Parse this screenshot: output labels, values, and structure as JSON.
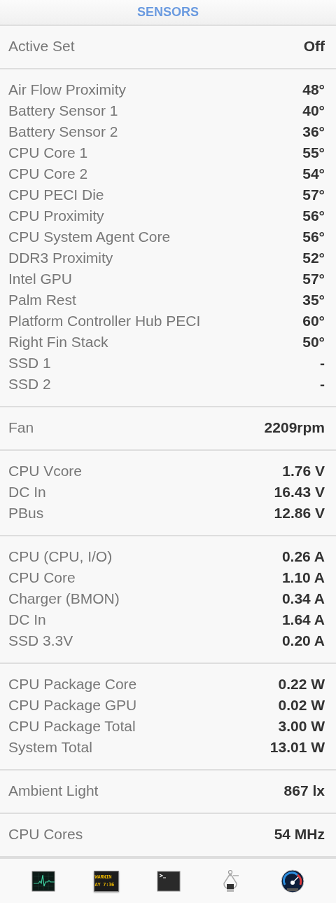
{
  "header": {
    "title": "SENSORS"
  },
  "sections": [
    {
      "rows": [
        {
          "label": "Active Set",
          "value": "Off"
        }
      ]
    },
    {
      "rows": [
        {
          "label": "Air Flow Proximity",
          "value": "48°"
        },
        {
          "label": "Battery Sensor 1",
          "value": "40°"
        },
        {
          "label": "Battery Sensor 2",
          "value": "36°"
        },
        {
          "label": "CPU Core 1",
          "value": "55°"
        },
        {
          "label": "CPU Core 2",
          "value": "54°"
        },
        {
          "label": "CPU PECI Die",
          "value": "57°"
        },
        {
          "label": "CPU Proximity",
          "value": "56°"
        },
        {
          "label": "CPU System Agent Core",
          "value": "56°"
        },
        {
          "label": "DDR3 Proximity",
          "value": "52°"
        },
        {
          "label": "Intel GPU",
          "value": "57°"
        },
        {
          "label": "Palm Rest",
          "value": "35°"
        },
        {
          "label": "Platform Controller Hub PECI",
          "value": "60°"
        },
        {
          "label": "Right Fin Stack",
          "value": "50°"
        },
        {
          "label": "SSD 1",
          "value": "-"
        },
        {
          "label": "SSD 2",
          "value": "-"
        }
      ]
    },
    {
      "rows": [
        {
          "label": "Fan",
          "value": "2209rpm"
        }
      ]
    },
    {
      "rows": [
        {
          "label": "CPU Vcore",
          "value": "1.76 V"
        },
        {
          "label": "DC In",
          "value": "16.43 V"
        },
        {
          "label": "PBus",
          "value": "12.86 V"
        }
      ]
    },
    {
      "rows": [
        {
          "label": "CPU (CPU, I/O)",
          "value": "0.26 A"
        },
        {
          "label": "CPU Core",
          "value": "1.10 A"
        },
        {
          "label": "Charger (BMON)",
          "value": "0.34 A"
        },
        {
          "label": "DC In",
          "value": "1.64 A"
        },
        {
          "label": "SSD 3.3V",
          "value": "0.20 A"
        }
      ]
    },
    {
      "rows": [
        {
          "label": "CPU Package Core",
          "value": "0.22 W"
        },
        {
          "label": "CPU Package GPU",
          "value": "0.02 W"
        },
        {
          "label": "CPU Package Total",
          "value": "3.00 W"
        },
        {
          "label": "System Total",
          "value": "13.01 W"
        }
      ]
    },
    {
      "rows": [
        {
          "label": "Ambient Light",
          "value": "867 lx"
        }
      ]
    },
    {
      "rows": [
        {
          "label": "CPU Cores",
          "value": "54 MHz"
        }
      ]
    }
  ],
  "dock": [
    {
      "kind": "activity"
    },
    {
      "kind": "console",
      "lines": [
        "WARNIN",
        "AY 7:36"
      ]
    },
    {
      "kind": "terminal"
    },
    {
      "kind": "caliper"
    },
    {
      "kind": "gauge"
    }
  ]
}
